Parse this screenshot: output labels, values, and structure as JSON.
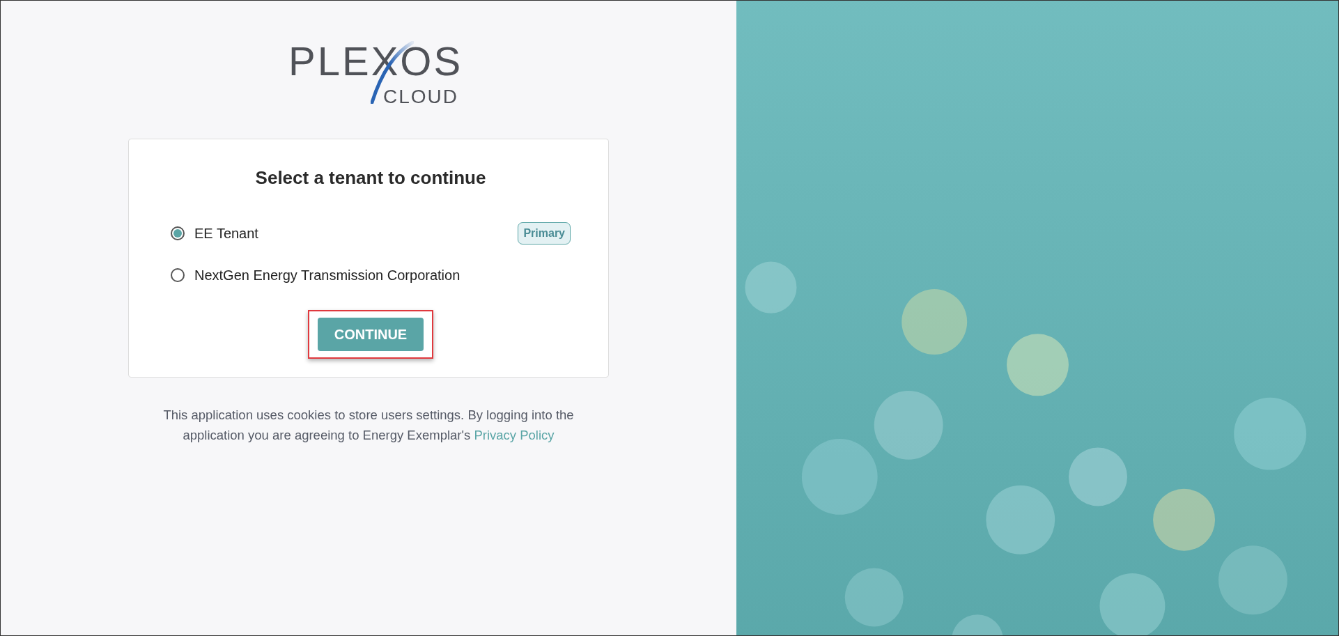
{
  "logo": {
    "wordmark": "PLEXOS",
    "subtitle": "CLOUD"
  },
  "card": {
    "title": "Select a tenant to continue",
    "tenants": [
      {
        "label": "EE Tenant",
        "selected": true,
        "badge": "Primary"
      },
      {
        "label": "NextGen Energy Transmission Corporation",
        "selected": false
      }
    ],
    "button": {
      "label": "CONTINUE",
      "highlighted": true
    }
  },
  "footer": {
    "text": "This application uses cookies to store users settings. By logging into the application you are agreeing to Energy Exemplar's ",
    "link": "Privacy Policy"
  }
}
